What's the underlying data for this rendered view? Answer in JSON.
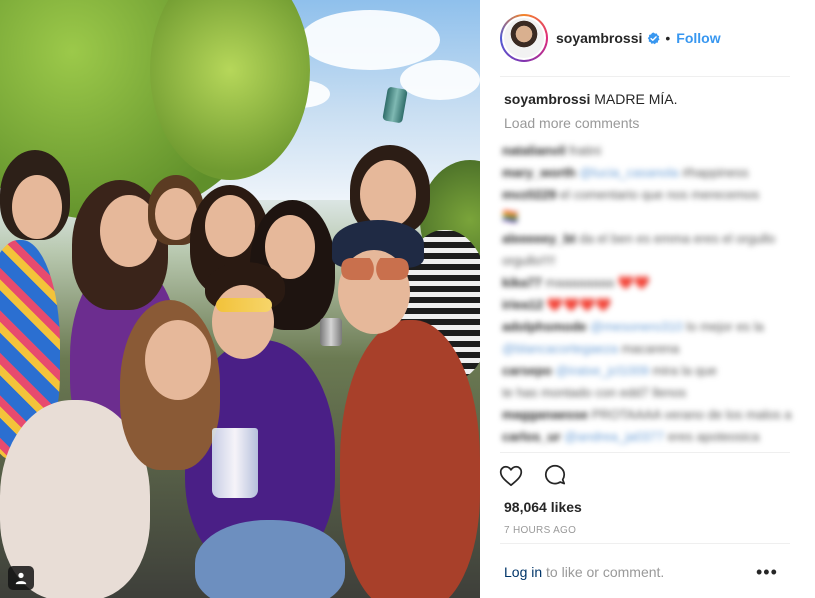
{
  "post": {
    "username": "soyambrossi",
    "follow_label": "Follow",
    "separator": "•",
    "caption_user": "soyambrossi",
    "caption_text": "MADRE MÍA.",
    "load_more": "Load more comments",
    "likes": "98,064 likes",
    "time_ago": "7 HOURS AGO",
    "login_link": "Log in",
    "login_suffix": " to like or comment.",
    "more_label": "•••"
  },
  "comments": [
    {
      "user": "natalianvil",
      "text": "fratini"
    },
    {
      "user": "mary_worth",
      "mention": "@lucia_casanola",
      "text": "#happiness"
    },
    {
      "user": "mvz0229",
      "text": "el comentario que nos merecemos"
    },
    {
      "user": "",
      "text": "🏳️‍🌈"
    },
    {
      "user": "aleeeeey_bt",
      "text": "da el ben es emma eres el orgullo"
    },
    {
      "user": "",
      "text": "orgullo!!!!"
    },
    {
      "user": "kika77",
      "text": "maaaaaaaa ❤️❤️"
    },
    {
      "user": "iriea12",
      "text": "❤️❤️❤️❤️"
    },
    {
      "user": "adolphsmode",
      "mention": "@mesonero310",
      "text": "lo mejor es la"
    },
    {
      "user": "",
      "mention": "@blancacortegaeza",
      "text": "macarena"
    },
    {
      "user": "carsepo",
      "mention": "@iratxe_jcl1009",
      "text": "mira la que"
    },
    {
      "user": "",
      "text": "te has montado con edd7 llenos"
    },
    {
      "user": "magganaesse",
      "text": "PROTAAAA verano de los malos amigos"
    },
    {
      "user": "carlos_ur",
      "mention": "@andrea_ja0377",
      "text": "eres apoteosica"
    }
  ],
  "icons": {
    "verified": "verified-badge-icon",
    "like": "heart-outline-icon",
    "comment": "speech-bubble-icon",
    "user_tag": "user-tag-icon"
  },
  "colors": {
    "accent": "#3897f0",
    "login": "#003569",
    "muted": "#999999"
  }
}
